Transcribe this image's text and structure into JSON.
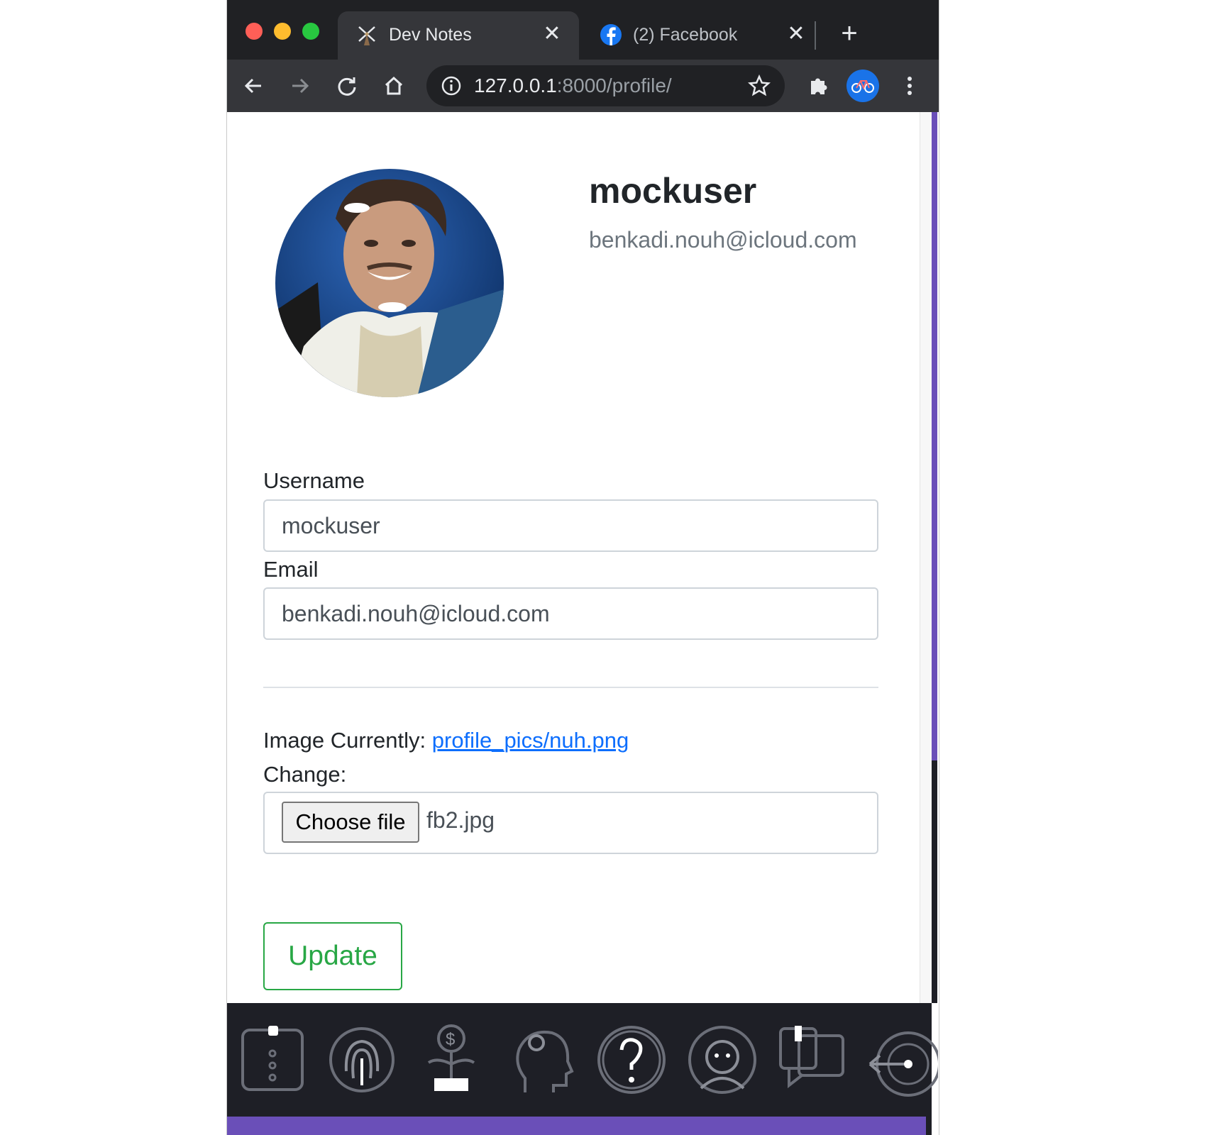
{
  "browser": {
    "tabs": [
      {
        "title": "Dev Notes",
        "active": true,
        "icon": "windmill-icon"
      },
      {
        "title": "(2) Facebook",
        "active": false,
        "icon": "facebook-icon"
      }
    ],
    "url_host": "127.0.0.1",
    "url_path": ":8000/profile/",
    "colors": {
      "chrome_dark": "#202124",
      "toolbar": "#35363a",
      "accent_purple": "#6a4fb8"
    }
  },
  "profile": {
    "username": "mockuser",
    "email": "benkadi.nouh@icloud.com"
  },
  "form": {
    "username_label": "Username",
    "username_value": "mockuser",
    "email_label": "Email",
    "email_value": "benkadi.nouh@icloud.com",
    "image_currently_label": "Image Currently:",
    "image_currently_link": "profile_pics/nuh.png",
    "change_label": "Change:",
    "choose_file_label": "Choose file",
    "chosen_file": "fb2.jpg",
    "update_label": "Update"
  },
  "dock": {
    "icons": [
      "shirt-icon",
      "fingerprint-icon",
      "money-plant-icon",
      "brain-gear-icon",
      "question-icon",
      "face-icon",
      "chat-bubbles-icon",
      "target-arrow-icon"
    ]
  }
}
